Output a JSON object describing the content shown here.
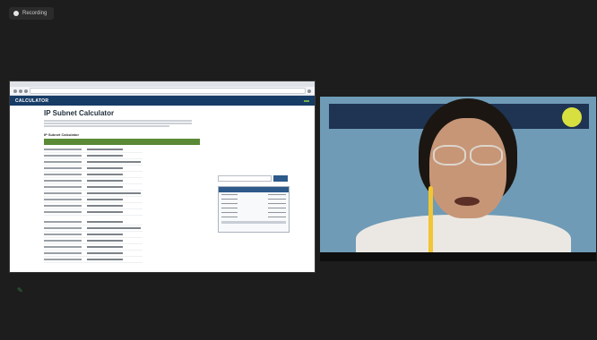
{
  "recording": {
    "label": "Recording"
  },
  "shared_screen": {
    "address_bar_url": "",
    "site": {
      "logo": "CALCULATOR",
      "nav": [
        "",
        "",
        "",
        ""
      ],
      "active_nav_index": 3
    },
    "page_title": "IP Subnet Calculator",
    "section_title": "IP Subnet Calculator"
  },
  "camera": {
    "banner_line1": "",
    "banner_line2": "",
    "logo_text": "",
    "participant_name": ""
  },
  "toolbar": {
    "annotate_icon": "pencil-icon"
  },
  "colors": {
    "background": "#1d1d1d",
    "site_header": "#173c66",
    "result_bar": "#5a8a36"
  }
}
